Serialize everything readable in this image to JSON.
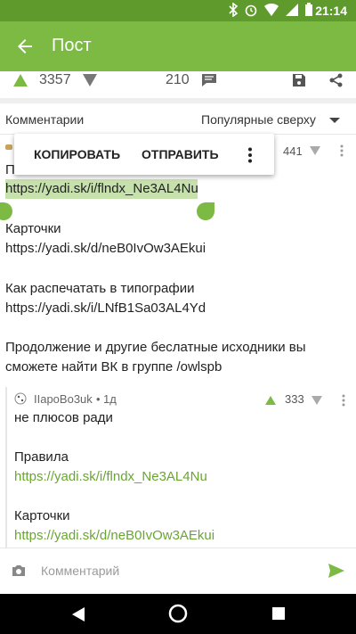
{
  "status_bar": {
    "time": "21:14"
  },
  "app_bar": {
    "title": "Пост"
  },
  "post_bar": {
    "score": "3357",
    "comment_count": "210"
  },
  "comments_header": {
    "title": "Комментарии",
    "sort": "Популярные сверху"
  },
  "context_menu": {
    "copy": "КОПИРОВАТЬ",
    "send": "ОТПРАВИТЬ"
  },
  "comment": {
    "score": "441",
    "lines": {
      "l0": "П",
      "l1": "https://yadi.sk/i/flndx_Ne3AL4Nu",
      "l2": "Карточки",
      "l3": "https://yadi.sk/d/neB0IvOw3AEkui",
      "l4": "Как распечатать в типографии",
      "l5": "https://yadi.sk/i/LNfB1Sa03AL4Yd",
      "l6": "Продолжение и другие беслатные исходники вы",
      "l7": "сможете найти ВК в группе /owlspb"
    }
  },
  "reply": {
    "author": "IIapoBo3uk",
    "time": "1д",
    "score": "333",
    "lines": {
      "l1": "не плюсов ради",
      "l2": "Правила",
      "l3": "https://yadi.sk/i/flndx_Ne3AL4Nu",
      "l4": "Карточки",
      "l5": "https://yadi.sk/d/neB0IvOw3AEkui"
    }
  },
  "input": {
    "placeholder": "Комментарий"
  },
  "colors": {
    "accent": "#7cba44",
    "status_bar": "#5f9a2d",
    "highlight": "#c7e1ac",
    "link": "#6aa533"
  }
}
